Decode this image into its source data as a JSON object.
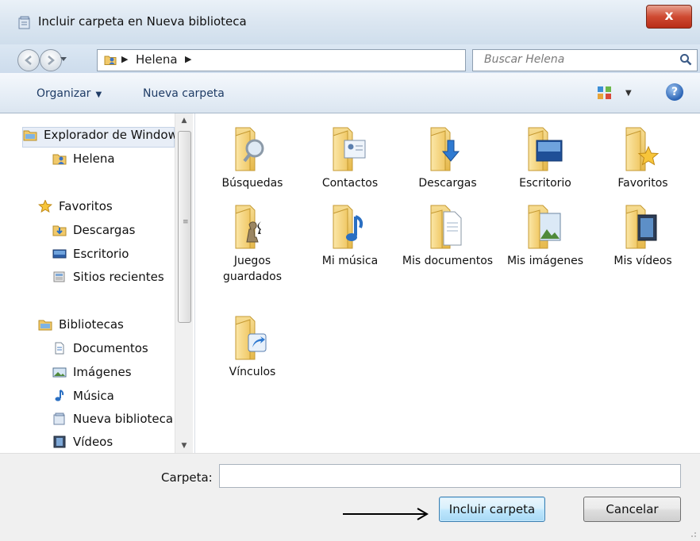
{
  "window": {
    "title": "Incluir carpeta en Nueva biblioteca",
    "close_label": "x"
  },
  "address_bar": {
    "segments": [
      "Helena"
    ],
    "search_placeholder": "Buscar Helena"
  },
  "toolbar": {
    "organize_label": "Organizar",
    "new_folder_label": "Nueva carpeta"
  },
  "nav_pane": {
    "items": [
      {
        "label": "Explorador de Windows",
        "icon": "explorer-folder-icon",
        "selected": true
      },
      {
        "label": "Helena",
        "icon": "user-folder-icon"
      },
      {
        "label": "Favoritos",
        "icon": "star-icon"
      },
      {
        "label": "Descargas",
        "icon": "downloads-icon"
      },
      {
        "label": "Escritorio",
        "icon": "desktop-icon"
      },
      {
        "label": "Sitios recientes",
        "icon": "recent-places-icon"
      },
      {
        "label": "Bibliotecas",
        "icon": "libraries-icon"
      },
      {
        "label": "Documentos",
        "icon": "document-icon"
      },
      {
        "label": "Imágenes",
        "icon": "pictures-icon"
      },
      {
        "label": "Música",
        "icon": "music-icon"
      },
      {
        "label": "Nueva biblioteca",
        "icon": "library-icon"
      },
      {
        "label": "Vídeos",
        "icon": "video-icon"
      }
    ]
  },
  "folders": [
    {
      "label": "Búsquedas",
      "icon": "searches-folder-icon"
    },
    {
      "label": "Contactos",
      "icon": "contacts-folder-icon"
    },
    {
      "label": "Descargas",
      "icon": "downloads-folder-icon"
    },
    {
      "label": "Escritorio",
      "icon": "desktop-folder-icon"
    },
    {
      "label": "Favoritos",
      "icon": "favorites-folder-icon"
    },
    {
      "label": "Juegos guardados",
      "icon": "saved-games-folder-icon"
    },
    {
      "label": "Mi música",
      "icon": "music-folder-icon"
    },
    {
      "label": "Mis documentos",
      "icon": "documents-folder-icon"
    },
    {
      "label": "Mis imágenes",
      "icon": "pictures-folder-icon"
    },
    {
      "label": "Mis vídeos",
      "icon": "videos-folder-icon"
    },
    {
      "label": "Vínculos",
      "icon": "links-folder-icon"
    }
  ],
  "bottom": {
    "folder_label": "Carpeta:",
    "folder_value": "",
    "include_button": "Incluir carpeta",
    "cancel_button": "Cancelar"
  },
  "colors": {
    "accent": "#3c7fb1",
    "folder_yellow": "#f3d37a",
    "toolbar_text": "#1f3c66"
  }
}
